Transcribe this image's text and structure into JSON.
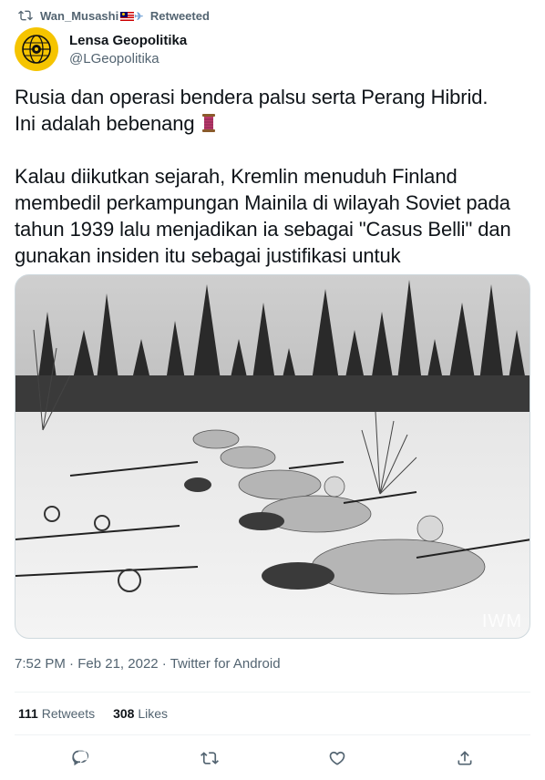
{
  "retweet": {
    "user": "Wan_Musashi",
    "label": "Retweeted",
    "icon": "retweet-icon"
  },
  "author": {
    "name": "Lensa Geopolitika",
    "handle": "@LGeopolitika",
    "avatar_logo_text": "LENSA GEOPOLITIKA"
  },
  "tweet": {
    "line1": "Rusia dan operasi bendera palsu serta Perang Hibrid.\nIni adalah bebenang",
    "paragraph2": "Kalau diikutkan sejarah, Kremlin menuduh Finland membedil perkampungan Mainila di wilayah Soviet pada tahun 1939 lalu menjadikan ia sebagai \"Casus Belli\" dan gunakan insiden itu sebagai justifikasi untuk",
    "thread_emoji": "thread-spool-icon"
  },
  "media": {
    "watermark": "IWM",
    "description_icon": "photo-soldiers-in-snow"
  },
  "meta": {
    "time": "7:52 PM",
    "separator": " · ",
    "date": "Feb 21, 2022",
    "source": "Twitter for Android"
  },
  "stats": {
    "retweets_count": "111",
    "retweets_label": "Retweets",
    "likes_count": "308",
    "likes_label": "Likes"
  },
  "actions": [
    "reply-icon",
    "retweet-icon",
    "like-icon",
    "share-icon"
  ],
  "colors": {
    "text": "#0f1419",
    "secondary": "#536471",
    "avatar": "#f5c400",
    "border": "#eff3f4"
  }
}
